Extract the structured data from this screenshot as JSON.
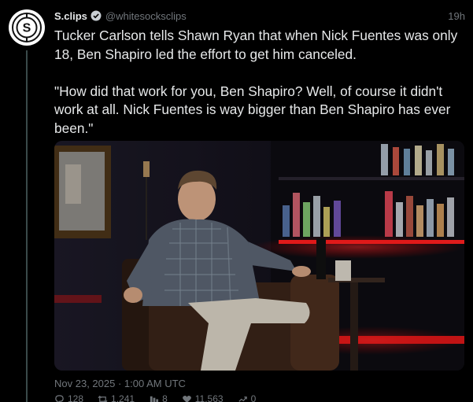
{
  "author": {
    "name": "S.clips",
    "handle": "@whitesocksclips",
    "time": "19h",
    "avatar_letter": "S"
  },
  "tweet": {
    "paragraph1": "Tucker Carlson tells Shawn Ryan that when Nick Fuentes was only 18, Ben Shapiro led the effort to get him canceled.",
    "paragraph2": "\"How did that work for you, Ben Shapiro? Well, of course it didn't work at all. Nick Fuentes is way bigger than Ben Shapiro has ever been.\"",
    "timestamp": "Nov 23, 2025 · 1:00 AM UTC"
  },
  "stats": {
    "replies": "128",
    "retweets": "1,241",
    "quotes": "8",
    "likes": "11,563",
    "views": "0"
  },
  "icons": {
    "avatar": "dollar-logo-icon",
    "verified": "verified-badge-icon",
    "reply": "reply-icon",
    "retweet": "retweet-icon",
    "quote": "quote-icon",
    "like": "heart-icon",
    "views": "views-icon"
  },
  "colors": {
    "background": "#000000",
    "text": "#e7e9ea",
    "muted": "#71767b",
    "thread_line": "#3a4a4a",
    "bar_glow": "#ff1a1a"
  }
}
